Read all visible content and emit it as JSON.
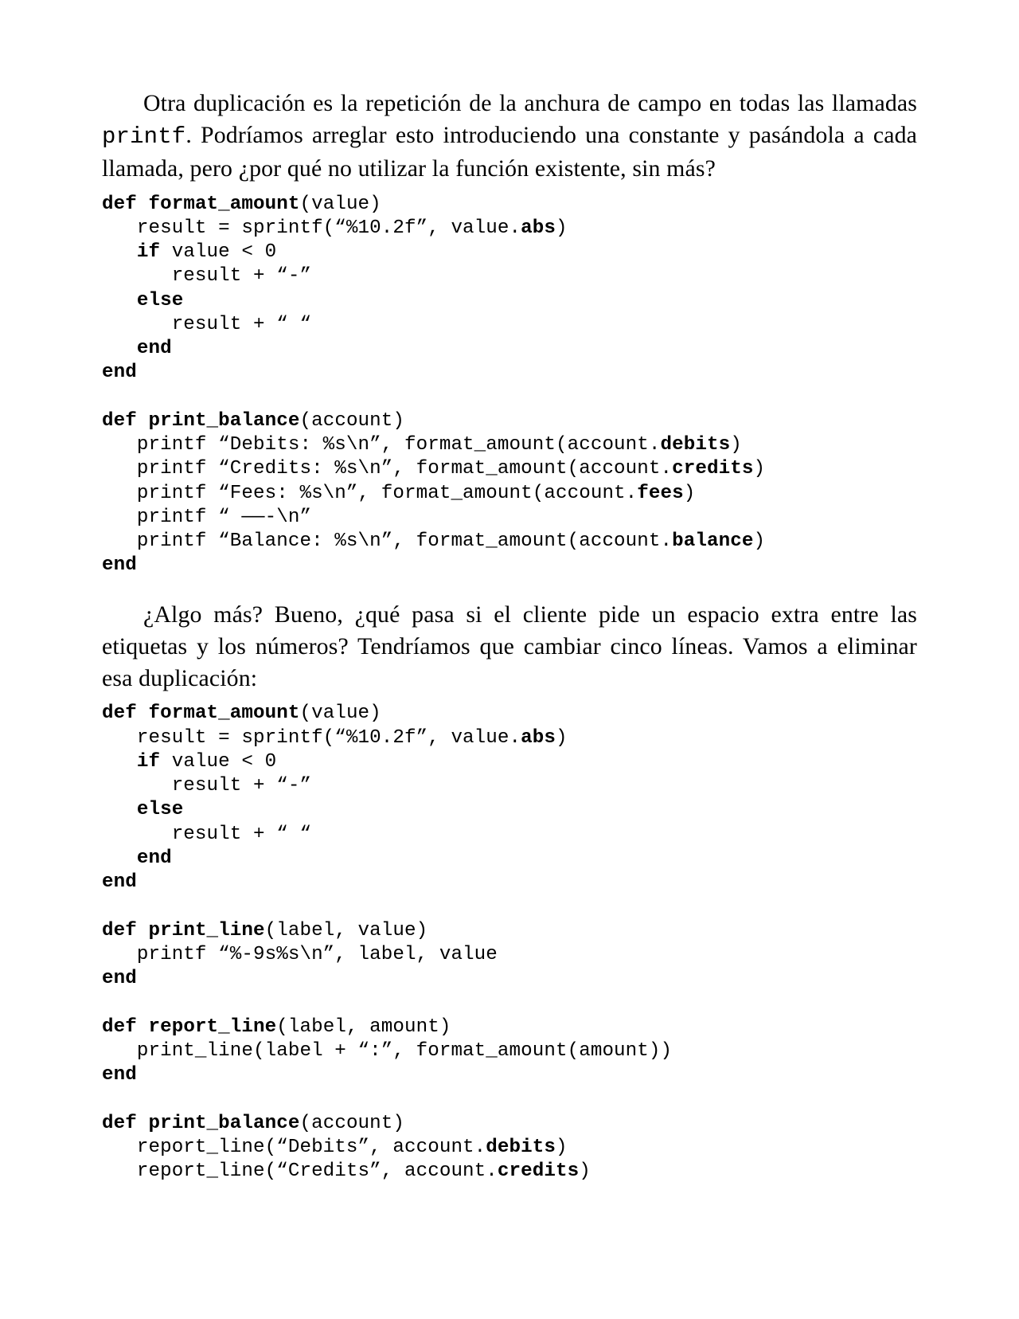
{
  "para1_pre": "Otra duplicación es la repetición de la anchura de campo en todas las llamadas ",
  "para1_code": "printf",
  "para1_post": ". Podríamos arreglar esto introduciendo una constante y pasándola a cada llamada, pero ¿por qué no utilizar la función existente, sin más?",
  "code1": {
    "l01a": "def",
    "l01b": " ",
    "l01c": "format_amount",
    "l01d": "(value)",
    "l02a": "   result = sprintf(“%10.2f”, value.",
    "l02b": "abs",
    "l02c": ")",
    "l03a": "   ",
    "l03b": "if",
    "l03c": " value < 0",
    "l04": "      result + “-”",
    "l05a": "   ",
    "l05b": "else",
    "l06": "      result + “ “",
    "l07a": "   ",
    "l07b": "end",
    "l08": "end",
    "blank1": "",
    "l09a": "def",
    "l09b": " ",
    "l09c": "print_balance",
    "l09d": "(account)",
    "l10a": "   printf “Debits: %s\\n”, format_amount(account.",
    "l10b": "debits",
    "l10c": ")",
    "l11a": "   printf “Credits: %s\\n”, format_amount(account.",
    "l11b": "credits",
    "l11c": ")",
    "l12a": "   printf “Fees: %s\\n”, format_amount(account.",
    "l12b": "fees",
    "l12c": ")",
    "l13": "   printf “ ——-\\n”",
    "l14a": "   printf “Balance: %s\\n”, format_amount(account.",
    "l14b": "balance",
    "l14c": ")",
    "l15": "end"
  },
  "para2": "¿Algo más? Bueno, ¿qué pasa si el cliente pide un espacio extra entre las etiquetas y los números? Tendríamos que cambiar cinco líneas. Vamos a eliminar esa duplicación:",
  "code2": {
    "l01a": "def",
    "l01b": " ",
    "l01c": "format_amount",
    "l01d": "(value)",
    "l02a": "   result = sprintf(“%10.2f”, value.",
    "l02b": "abs",
    "l02c": ")",
    "l03a": "   ",
    "l03b": "if",
    "l03c": " value < 0",
    "l04": "      result + “-”",
    "l05a": "   ",
    "l05b": "else",
    "l06": "      result + “ “",
    "l07a": "   ",
    "l07b": "end",
    "l08": "end",
    "blank1": "",
    "l09a": "def",
    "l09b": " ",
    "l09c": "print_line",
    "l09d": "(label, value)",
    "l10": "   printf “%-9s%s\\n”, label, value",
    "l11": "end",
    "blank2": "",
    "l12a": "def",
    "l12b": " ",
    "l12c": "report_line",
    "l12d": "(label, amount)",
    "l13": "   print_line(label + “:”, format_amount(amount))",
    "l14": "end",
    "blank3": "",
    "l15a": "def",
    "l15b": " ",
    "l15c": "print_balance",
    "l15d": "(account)",
    "l16a": "   report_line(“Debits”, account.",
    "l16b": "debits",
    "l16c": ")",
    "l17a": "   report_line(“Credits”, account.",
    "l17b": "credits",
    "l17c": ")"
  }
}
